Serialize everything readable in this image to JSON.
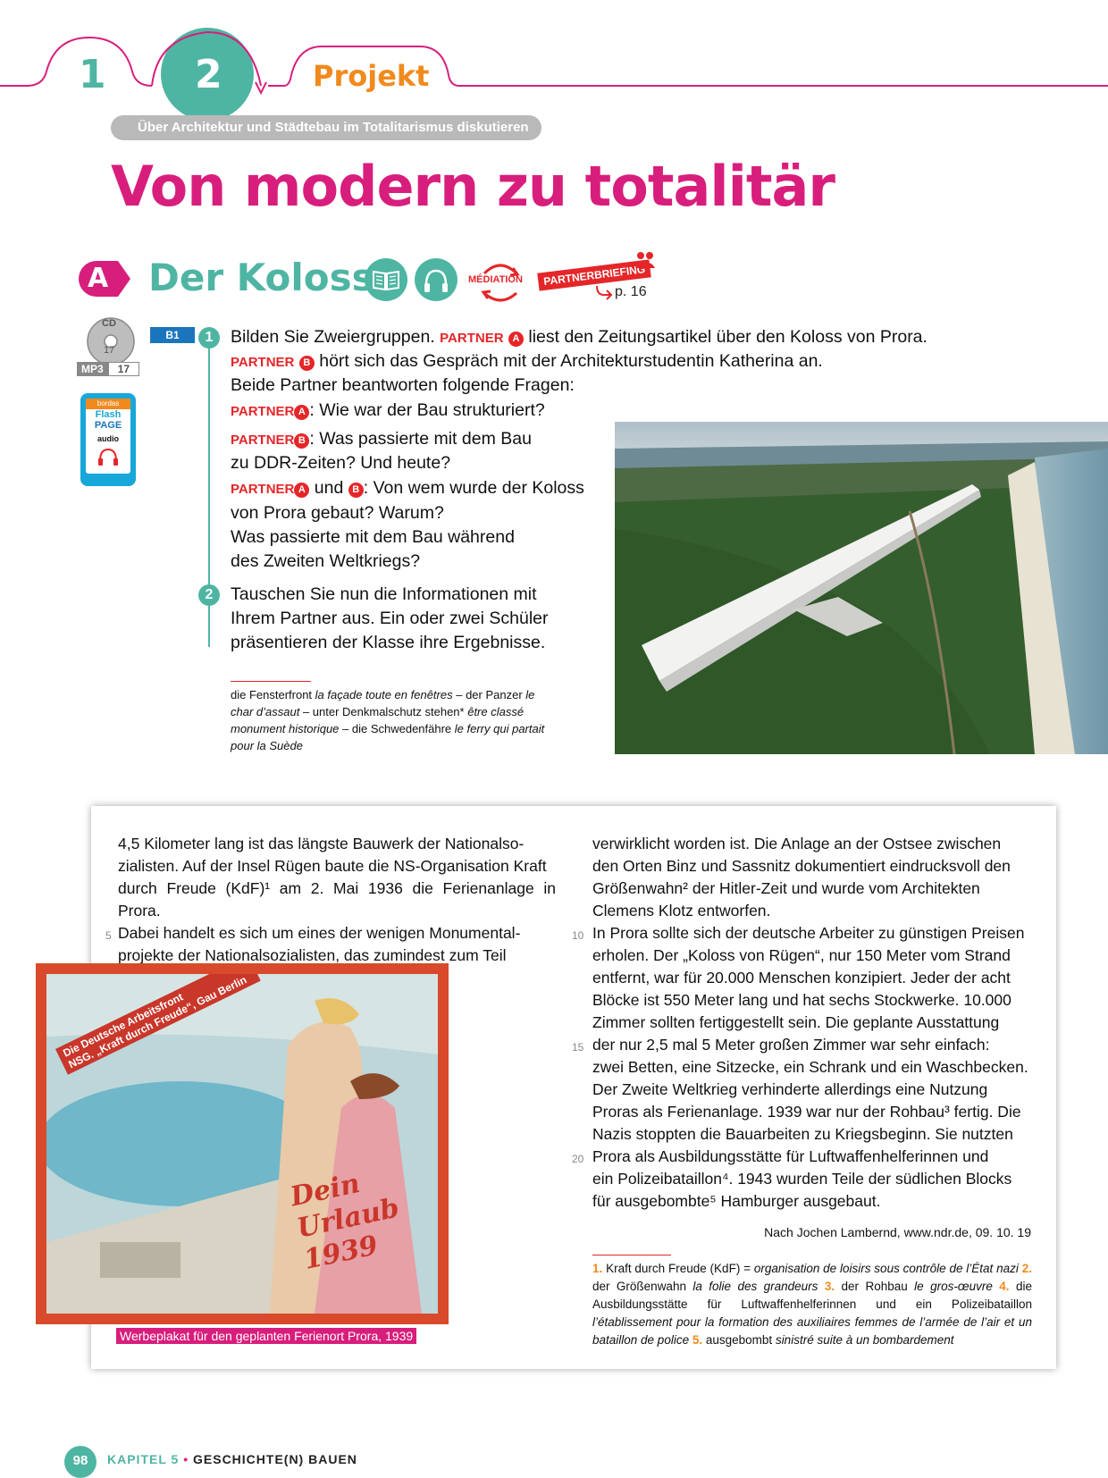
{
  "header": {
    "tab1": "1",
    "tab2": "2",
    "tab3": "Projekt",
    "subtitle": "Über Architektur und Städtebau im Totalitarismus diskutieren",
    "title": "Von modern zu totalitär"
  },
  "section": {
    "letter": "A",
    "title": "Der Koloss",
    "mediation": "MÉDIATION",
    "partnerbriefing": "PARTNERBRIEFING",
    "partnerbriefing_ref": "p. 16"
  },
  "media": {
    "cd_label": "CD",
    "cd_track": "17",
    "mp3_label": "MP3",
    "mp3_track": "17",
    "flash_brand": "bordas",
    "flash_line1": "Flash",
    "flash_line2": "PAGE",
    "flash_line3": "audio"
  },
  "task": {
    "level": "B1",
    "step1": "1",
    "step2": "2",
    "partner": "PARTNER",
    "a": "A",
    "b": "B",
    "l1_rest": " liest den Zeitungsartikel über den Koloss von Prora.",
    "l0": "Bilden Sie Zweiergruppen.",
    "l2_rest": " hört sich das Gespräch mit der Architekturstudentin Katherina an.",
    "l3": "Beide Partner beantworten folgende Fragen:",
    "l4_rest": ": Wie war der Bau strukturiert?",
    "l5_rest": ": Was passierte mit dem Bau",
    "l6": "zu DDR-Zeiten? Und heute?",
    "l7_und": " und ",
    "l7_rest": ": Von wem wurde der Koloss",
    "l8": "von Prora gebaut? Warum?",
    "l9": "Was passierte mit dem Bau während",
    "l10": "des Zweiten Weltkriegs?",
    "l11": "Tauschen Sie nun die Informationen mit",
    "l12": "Ihrem Partner aus. Ein oder zwei Schüler",
    "l13": "präsentieren der Klasse ihre Ergebnisse."
  },
  "glossary": {
    "g1": "die Fensterfront ",
    "g1i": "la façade toute en fenêtres",
    "g2": " – der Panzer ",
    "g2i": "le char d’assaut",
    "g3": " – unter Denkmalschutz stehen* ",
    "g3i": "être classé monument historique",
    "g4": " – die Schwedenfähre ",
    "g4i": "le ferry qui partait pour la Suède"
  },
  "article": {
    "left": [
      "4,5 Kilometer lang ist das längste Bauwerk der Nationalso-",
      "zialisten. Auf der Insel Rügen baute die NS-Organisation Kraft",
      "durch Freude (KdF)¹ am 2. Mai 1936 die Ferienanlage in Prora.",
      "Dabei handelt es sich um eines der wenigen Monumental-",
      "projekte der Nationalsozialisten, das zumindest zum Teil"
    ],
    "right": [
      "verwirklicht worden ist. Die Anlage an der Ostsee zwischen",
      "den Orten Binz und Sassnitz dokumentiert eindrucksvoll den",
      "Größenwahn² der Hitler-Zeit und wurde vom Architekten",
      "Clemens Klotz entworfen.",
      "In Prora sollte sich der deutsche Arbeiter zu günstigen Preisen",
      "erholen. Der „Koloss von Rügen“, nur 150 Meter vom Strand",
      "entfernt, war für 20.000 Menschen konzipiert. Jeder der acht",
      "Blöcke ist 550 Meter lang und hat sechs Stockwerke. 10.000",
      "Zimmer sollten fertiggestellt sein. Die geplante Ausstattung",
      "der nur 2,5 mal 5 Meter großen Zimmer war sehr einfach:",
      "zwei Betten, eine Sitzecke, ein Schrank und ein Waschbecken.",
      "Der Zweite Weltkrieg verhinderte allerdings eine Nutzung",
      "Proras als Ferienanlage. 1939 war nur der Rohbau³ fertig. Die",
      "Nazis stoppten die Bauarbeiten zu Kriegsbeginn. Sie nutzten",
      "Prora als Ausbildungsstätte für Luftwaffenhelferinnen und",
      "ein Polizeibataillon⁴. 1943 wurden Teile der südlichen Blocks",
      "für ausgebombte⁵ Hamburger ausgebaut."
    ],
    "line_numbers": [
      "5",
      "10",
      "15",
      "20"
    ],
    "source": "Nach Jochen Lambernd, www.ndr.de, 09. 10. 19",
    "caption": "Werbeplakat für den geplanten Ferienort Prora, 1939"
  },
  "poster": {
    "banner1": "Die Deutsche Arbeitsfront",
    "banner2": "NSG. „Kraft durch Freude“, Gau Berlin",
    "script1": "Dein",
    "script2": "Urlaub",
    "script3": "1939"
  },
  "footnotes": {
    "n1": "1.",
    "t1": " Kraft durch Freude (KdF) = ",
    "t1i": "organisation de loisirs sous contrôle de l’État nazi",
    "n2": "2.",
    "t2": " der Größenwahn ",
    "t2i": "la folie des grandeurs",
    "n3": "3.",
    "t3": " der Rohbau ",
    "t3i": "le gros-œuvre",
    "n4": "4.",
    "t4": " die Ausbildungsstätte für Luftwaffenhelferinnen und ein Polizeibataillon ",
    "t4i": "l’établissement pour la formation des auxiliaires femmes de l’armée de l’air et un bataillon de police",
    "n5": "5.",
    "t5": " ausgebombt ",
    "t5i": "sinistré suite à un bombardement"
  },
  "footer": {
    "page": "98",
    "chapter": "KAPITEL 5",
    "bullet": "•",
    "topic": "GESCHICHTE(N) BAUEN"
  },
  "colors": {
    "magenta": "#d81e7c",
    "teal": "#4fb5a3",
    "orange": "#f18a1d",
    "red": "#e52629",
    "blue": "#1a75bc"
  }
}
